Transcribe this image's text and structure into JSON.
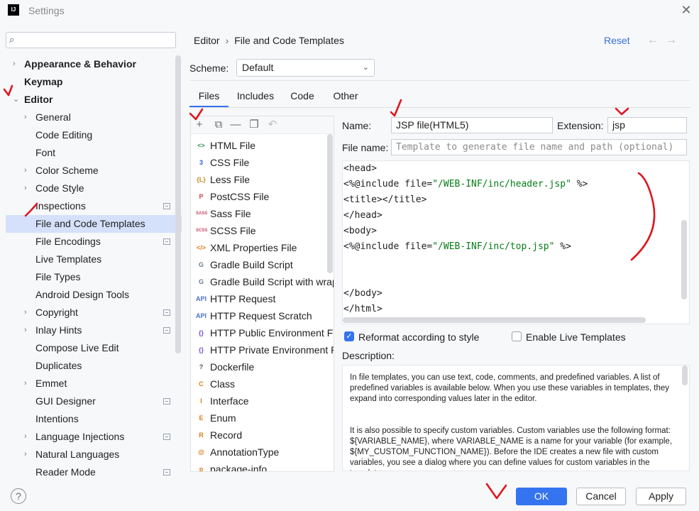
{
  "window": {
    "title": "Settings",
    "app_icon_text": "IJ"
  },
  "search": {
    "placeholder": ""
  },
  "tree": [
    {
      "label": "Appearance & Behavior",
      "arrow": "right",
      "bold": true
    },
    {
      "label": "Keymap",
      "arrow": "",
      "bold": true
    },
    {
      "label": "Editor",
      "arrow": "down",
      "bold": true
    },
    {
      "label": "General",
      "arrow": "right"
    },
    {
      "label": "Code Editing",
      "arrow": ""
    },
    {
      "label": "Font",
      "arrow": ""
    },
    {
      "label": "Color Scheme",
      "arrow": "right"
    },
    {
      "label": "Code Style",
      "arrow": "right"
    },
    {
      "label": "Inspections",
      "arrow": "",
      "project": true
    },
    {
      "label": "File and Code Templates",
      "arrow": "",
      "selected": true
    },
    {
      "label": "File Encodings",
      "arrow": "",
      "project": true
    },
    {
      "label": "Live Templates",
      "arrow": ""
    },
    {
      "label": "File Types",
      "arrow": ""
    },
    {
      "label": "Android Design Tools",
      "arrow": ""
    },
    {
      "label": "Copyright",
      "arrow": "right",
      "project": true
    },
    {
      "label": "Inlay Hints",
      "arrow": "right",
      "project": true
    },
    {
      "label": "Compose Live Edit",
      "arrow": ""
    },
    {
      "label": "Duplicates",
      "arrow": ""
    },
    {
      "label": "Emmet",
      "arrow": "right"
    },
    {
      "label": "GUI Designer",
      "arrow": "",
      "project": true
    },
    {
      "label": "Intentions",
      "arrow": ""
    },
    {
      "label": "Language Injections",
      "arrow": "right",
      "project": true
    },
    {
      "label": "Natural Languages",
      "arrow": "right"
    },
    {
      "label": "Reader Mode",
      "arrow": "",
      "project": true
    }
  ],
  "breadcrumb": {
    "part1": "Editor",
    "separator": "›",
    "part2": "File and Code Templates"
  },
  "reset_label": "Reset",
  "scheme": {
    "label": "Scheme:",
    "value": "Default"
  },
  "tabs": [
    "Files",
    "Includes",
    "Code",
    "Other"
  ],
  "files": [
    {
      "name": "HTML File",
      "icon": "<>",
      "color": "#3d8f58"
    },
    {
      "name": "CSS File",
      "icon": "3",
      "color": "#2f5fd0"
    },
    {
      "name": "Less File",
      "icon": "{L}",
      "color": "#c88a1a"
    },
    {
      "name": "PostCSS File",
      "icon": "P",
      "color": "#d64545"
    },
    {
      "name": "Sass File",
      "icon": "SASS",
      "color": "#c24a6b"
    },
    {
      "name": "SCSS File",
      "icon": "SCSS",
      "color": "#c24a6b"
    },
    {
      "name": "XML Properties File",
      "icon": "</>",
      "color": "#e07a1a"
    },
    {
      "name": "Gradle Build Script",
      "icon": "G",
      "color": "#6b7b8c"
    },
    {
      "name": "Gradle Build Script with wrap",
      "icon": "G",
      "color": "#6b7b8c"
    },
    {
      "name": "HTTP Request",
      "icon": "API",
      "color": "#4a72c9"
    },
    {
      "name": "HTTP Request Scratch",
      "icon": "API",
      "color": "#4a72c9"
    },
    {
      "name": "HTTP Public Environment Fil",
      "icon": "{}",
      "color": "#7a4fc9"
    },
    {
      "name": "HTTP Private Environment F",
      "icon": "{}",
      "color": "#7a4fc9"
    },
    {
      "name": "Dockerfile",
      "icon": "?",
      "color": "#555555"
    },
    {
      "name": "Class",
      "icon": "C",
      "color": "#e07a1a"
    },
    {
      "name": "Interface",
      "icon": "I",
      "color": "#e07a1a"
    },
    {
      "name": "Enum",
      "icon": "E",
      "color": "#e07a1a"
    },
    {
      "name": "Record",
      "icon": "R",
      "color": "#e07a1a"
    },
    {
      "name": "AnnotationType",
      "icon": "@",
      "color": "#e07a1a"
    },
    {
      "name": "package-info",
      "icon": "p",
      "color": "#e07a1a"
    }
  ],
  "form": {
    "name_label": "Name:",
    "name_value": "JSP file(HTML5)",
    "ext_label": "Extension:",
    "ext_value": "jsp",
    "filename_label": "File name:",
    "filename_placeholder": "Template to generate file name and path (optional)"
  },
  "code_lines": [
    {
      "pre": "<head>",
      "str": "",
      "post": ""
    },
    {
      "pre": "<%@include file=",
      "str": "\"/WEB-INF/inc/header.jsp\"",
      "post": " %>"
    },
    {
      "pre": "<title></title>",
      "str": "",
      "post": ""
    },
    {
      "pre": "</head>",
      "str": "",
      "post": ""
    },
    {
      "pre": "<body>",
      "str": "",
      "post": ""
    },
    {
      "pre": "<%@include file=",
      "str": "\"/WEB-INF/inc/top.jsp\"",
      "post": " %>"
    },
    {
      "pre": "",
      "str": "",
      "post": ""
    },
    {
      "pre": "",
      "str": "",
      "post": ""
    },
    {
      "pre": "</body>",
      "str": "",
      "post": ""
    },
    {
      "pre": "</html>",
      "str": "",
      "post": ""
    }
  ],
  "options": {
    "reformat_label": "Reformat according to style",
    "reformat_checked": true,
    "live_label": "Enable Live Templates",
    "live_checked": false
  },
  "description": {
    "label": "Description:",
    "p1": "In file templates, you can use text, code, comments, and predefined variables. A list of predefined variables is available below. When you use these variables in templates, they expand into corresponding values later in the editor.",
    "p2": "It is also possible to specify custom variables. Custom variables use the following format: ${VARIABLE_NAME}, where VARIABLE_NAME is a name for your variable (for example, ${MY_CUSTOM_FUNCTION_NAME}). Before the IDE creates a new file with custom variables, you see a dialog where you can define values for custom variables in the template."
  },
  "buttons": {
    "ok": "OK",
    "cancel": "Cancel",
    "apply": "Apply",
    "help": "?"
  },
  "colors": {
    "accent": "#3574f0",
    "selection": "#d5e1fb",
    "annotation": "#e0161f"
  }
}
